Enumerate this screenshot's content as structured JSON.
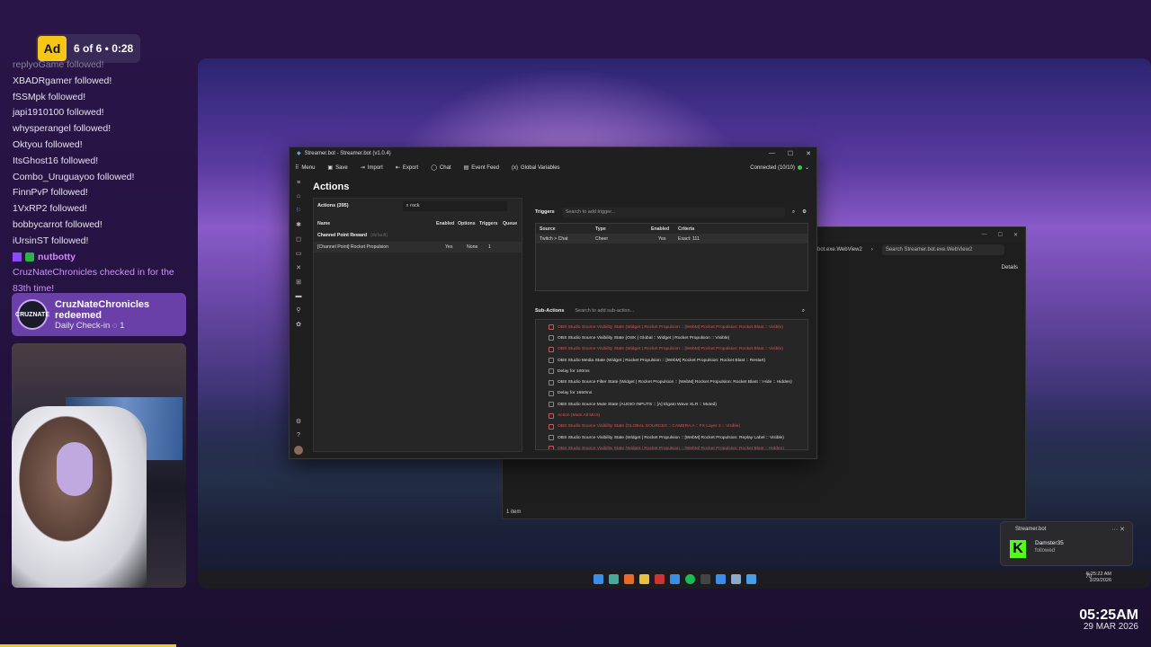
{
  "ad": {
    "badge": "Ad",
    "count": "6 of 6 • 0:28"
  },
  "feed": {
    "faded": "replyoGame followed!",
    "events": [
      "XBADRgamer followed!",
      "fSSMpk followed!",
      "japi1910100 followed!",
      "whysperangel followed!",
      "Oktyou followed!",
      "ItsGhost16 followed!",
      "Combo_Uruguayoo followed!",
      "FinnPvP followed!",
      "1VxRP2 followed!",
      "bobbycarrot followed!",
      "iUrsinST followed!"
    ],
    "bot_name": "nutbotty",
    "bot_message": "CruzNateChronicles checked in for the 83th time!"
  },
  "redeem": {
    "avatar_text": "CRUZNATE",
    "user": "CruzNateChronicles",
    "action": "redeemed",
    "reward": "Daily Check-in",
    "cost": "1"
  },
  "streamerbot": {
    "title": "Streamer.bot - Streamer.bot (v1.0.4)",
    "menu": [
      "Menu",
      "Save",
      "Import",
      "Export",
      "Chat",
      "Event Feed",
      "Global Variables"
    ],
    "connection": "Connected (10/10)",
    "page_title": "Actions",
    "actions_label": "Actions (395)",
    "search_value": "rock",
    "columns": [
      "Name",
      "Enabled",
      "Options",
      "Triggers",
      "Queue"
    ],
    "group": "Channel Point Reward",
    "group_hint": "(default)",
    "row": {
      "name": "[Channel Point] Rocket Propulsion",
      "enabled": "Yes",
      "options": "None",
      "triggers": "1"
    },
    "triggers": {
      "label": "Triggers",
      "placeholder": "Search to add trigger...",
      "columns": [
        "Source",
        "Type",
        "Enabled",
        "Criteria"
      ],
      "row": {
        "source": "Twitch > Chat",
        "type": "Cheer",
        "enabled": "Yes",
        "criteria": "Exact: 111"
      }
    },
    "subactions": {
      "label": "Sub-Actions",
      "placeholder": "Search to add sub-action...",
      "items": [
        {
          "text": "OBS Studio Source Visibility State (Widget | Rocket Propulsion :: [WebM] Rocket Propulsion: Rocket Blast :: Visible)",
          "disabled": true
        },
        {
          "text": "OBS Studio Source Visibility State (OSK | Global :: Widget | Rocket Propulsion :: Visible)",
          "disabled": false
        },
        {
          "text": "OBS Studio Source Visibility State (Widget | Rocket Propulsion :: [WebM] Rocket Propulsion: Rocket Blast :: Visible)",
          "disabled": true
        },
        {
          "text": "OBS Studio Media State (Widget | Rocket Propulsion :: [WebM] Rocket Propulsion: Rocket Blast :: Restart)",
          "disabled": false
        },
        {
          "text": "Delay for 100ms",
          "disabled": false
        },
        {
          "text": "OBS Studio Source Filter State (Widget | Rocket Propulsion :: [WebM] Rocket Propulsion: Rocket Blast :: Hide :: Hidden)",
          "disabled": false
        },
        {
          "text": "Delay for 1650ms",
          "disabled": false
        },
        {
          "text": "OBS Studio Source Mute State (AUDIO INPUTS :: [A] Elgato Wave XLR :: Muted)",
          "disabled": false
        },
        {
          "text": "Action (Mute All Mics)",
          "disabled": true
        },
        {
          "text": "OBS Studio Source Visibility State (GLOBAL SOURCES :: CAMERA A :: FX Layer 3 :: Visible)",
          "disabled": true
        },
        {
          "text": "OBS Studio Source Visibility State (Widget | Rocket Propulsion :: [WebM] Rocket Propulsion: Replay Label :: Visible)",
          "disabled": false
        },
        {
          "text": "OBS Studio Source Visibility State (Widget | Rocket Propulsion :: [WebM] Rocket Propulsion: Rocket Blast :: Hidden)",
          "disabled": true
        }
      ]
    }
  },
  "webview": {
    "tab": "bot.exe.WebView2",
    "search": "Search Streamer.bot.exe.WebView2",
    "details": "Details",
    "status": "1 item"
  },
  "toast": {
    "app": "Streamer.bot",
    "name": "Damster35",
    "sub": "followed"
  },
  "taskbar": {
    "temp": "70",
    "time": "5:25:22 AM",
    "date": "3/29/2026"
  },
  "overlay_clock": {
    "time": "05:25AM",
    "date": "29 MAR 2026"
  },
  "colors": {
    "accent": "#9146ff",
    "ad": "#f5c518",
    "kick": "#53fc18",
    "disabled": "#d05858"
  }
}
